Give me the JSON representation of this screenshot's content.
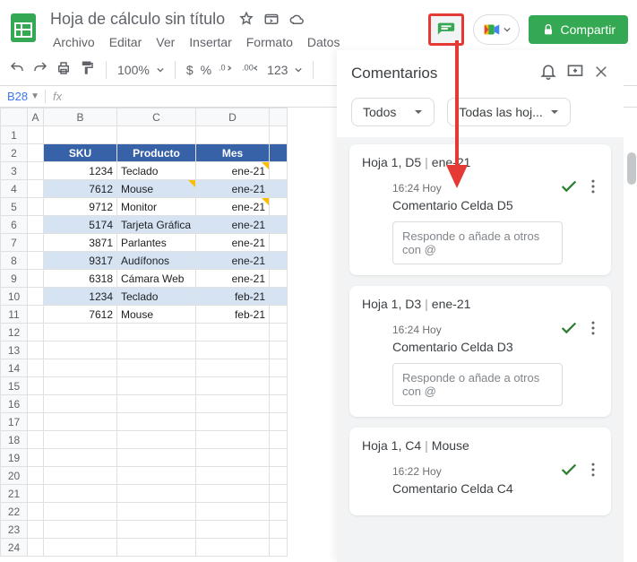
{
  "header": {
    "doc_title": "Hoja de cálculo sin título",
    "share_label": "Compartir",
    "menus": [
      "Archivo",
      "Editar",
      "Ver",
      "Insertar",
      "Formato",
      "Datos"
    ]
  },
  "toolbar": {
    "zoom": "100%",
    "currency": "$",
    "percent": "%",
    "number_format": "123"
  },
  "namebox": "B28",
  "fx_label": "fx",
  "columns": [
    "A",
    "B",
    "C",
    "D"
  ],
  "sheet": {
    "headers": {
      "B": "SKU",
      "C": "Producto",
      "D": "Mes"
    },
    "rows": [
      {
        "sku": "1234",
        "producto": "Teclado",
        "mes": "ene-21",
        "stripe": false,
        "mark_c": false,
        "mark_d": true
      },
      {
        "sku": "7612",
        "producto": "Mouse",
        "mes": "ene-21",
        "stripe": true,
        "mark_c": true,
        "mark_d": false
      },
      {
        "sku": "9712",
        "producto": "Monitor",
        "mes": "ene-21",
        "stripe": false,
        "mark_c": false,
        "mark_d": true
      },
      {
        "sku": "5174",
        "producto": "Tarjeta Gráfica",
        "mes": "ene-21",
        "stripe": true,
        "mark_c": false,
        "mark_d": false
      },
      {
        "sku": "3871",
        "producto": "Parlantes",
        "mes": "ene-21",
        "stripe": false,
        "mark_c": false,
        "mark_d": false
      },
      {
        "sku": "9317",
        "producto": "Audífonos",
        "mes": "ene-21",
        "stripe": true,
        "mark_c": false,
        "mark_d": false
      },
      {
        "sku": "6318",
        "producto": "Cámara Web",
        "mes": "ene-21",
        "stripe": false,
        "mark_c": false,
        "mark_d": false
      },
      {
        "sku": "1234",
        "producto": "Teclado",
        "mes": "feb-21",
        "stripe": true,
        "mark_c": false,
        "mark_d": false
      },
      {
        "sku": "7612",
        "producto": "Mouse",
        "mes": "feb-21",
        "stripe": false,
        "mark_c": false,
        "mark_d": false
      }
    ]
  },
  "comments_panel": {
    "title": "Comentarios",
    "filter_all": "Todos",
    "filter_sheets": "Todas las hoj...",
    "reply_placeholder": "Responde o añade a otros con @"
  },
  "comments": [
    {
      "sheet": "Hoja 1",
      "cell": "D5",
      "context": "ene-21",
      "time": "16:24 Hoy",
      "text": "Comentario Celda D5"
    },
    {
      "sheet": "Hoja 1",
      "cell": "D3",
      "context": "ene-21",
      "time": "16:24 Hoy",
      "text": "Comentario Celda D3"
    },
    {
      "sheet": "Hoja 1",
      "cell": "C4",
      "context": "Mouse",
      "time": "16:22 Hoy",
      "text": "Comentario Celda C4"
    }
  ]
}
